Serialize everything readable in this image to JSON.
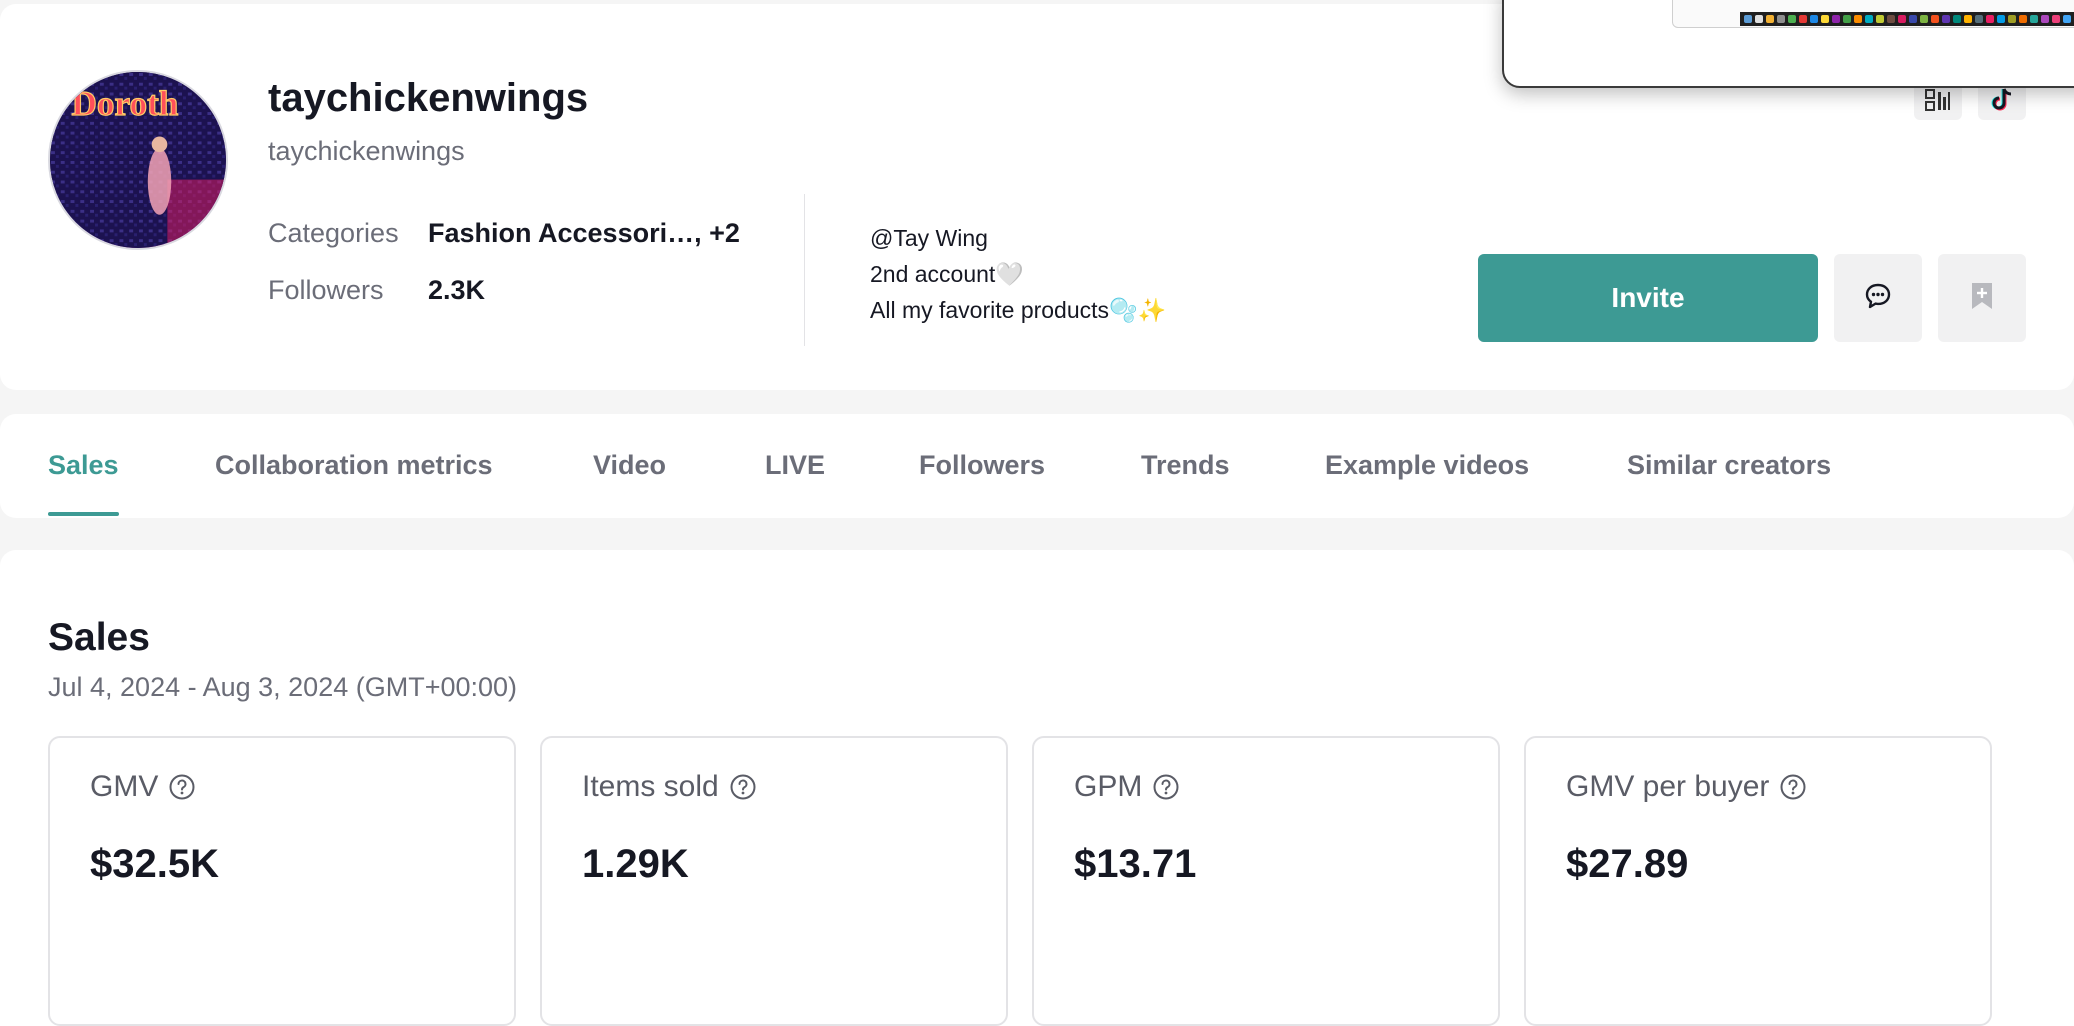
{
  "profile": {
    "username": "taychickenwings",
    "handle": "taychickenwings",
    "categories_label": "Categories",
    "categories_value": "Fashion Accessori…, +2",
    "followers_label": "Followers",
    "followers_value": "2.3K",
    "bio": [
      "@Tay Wing",
      "2nd account🤍",
      "All my favorite products🫧✨"
    ],
    "invite_label": "Invite",
    "avatar_sign": "Doroth"
  },
  "tabs": [
    {
      "label": "Sales",
      "active": true
    },
    {
      "label": "Collaboration metrics",
      "active": false
    },
    {
      "label": "Video",
      "active": false
    },
    {
      "label": "LIVE",
      "active": false
    },
    {
      "label": "Followers",
      "active": false
    },
    {
      "label": "Trends",
      "active": false
    },
    {
      "label": "Example videos",
      "active": false
    },
    {
      "label": "Similar creators",
      "active": false
    }
  ],
  "sales": {
    "title": "Sales",
    "date_range": "Jul 4, 2024 - Aug 3, 2024 (GMT+00:00)",
    "metrics": [
      {
        "label": "GMV",
        "value": "$32.5K"
      },
      {
        "label": "Items sold",
        "value": "1.29K"
      },
      {
        "label": "GPM",
        "value": "$13.71"
      },
      {
        "label": "GMV per buyer",
        "value": "$27.89"
      }
    ]
  },
  "colors": {
    "accent": "#3d9a94",
    "text_primary": "#161823",
    "text_secondary": "#6b6d78",
    "background": "#f5f5f5"
  },
  "icons": {
    "message": "message-bubble-icon",
    "save": "bookmark-plus-icon",
    "qr": "qr-code-icon",
    "tiktok": "tiktok-logo-icon",
    "help": "question-circle-icon"
  }
}
